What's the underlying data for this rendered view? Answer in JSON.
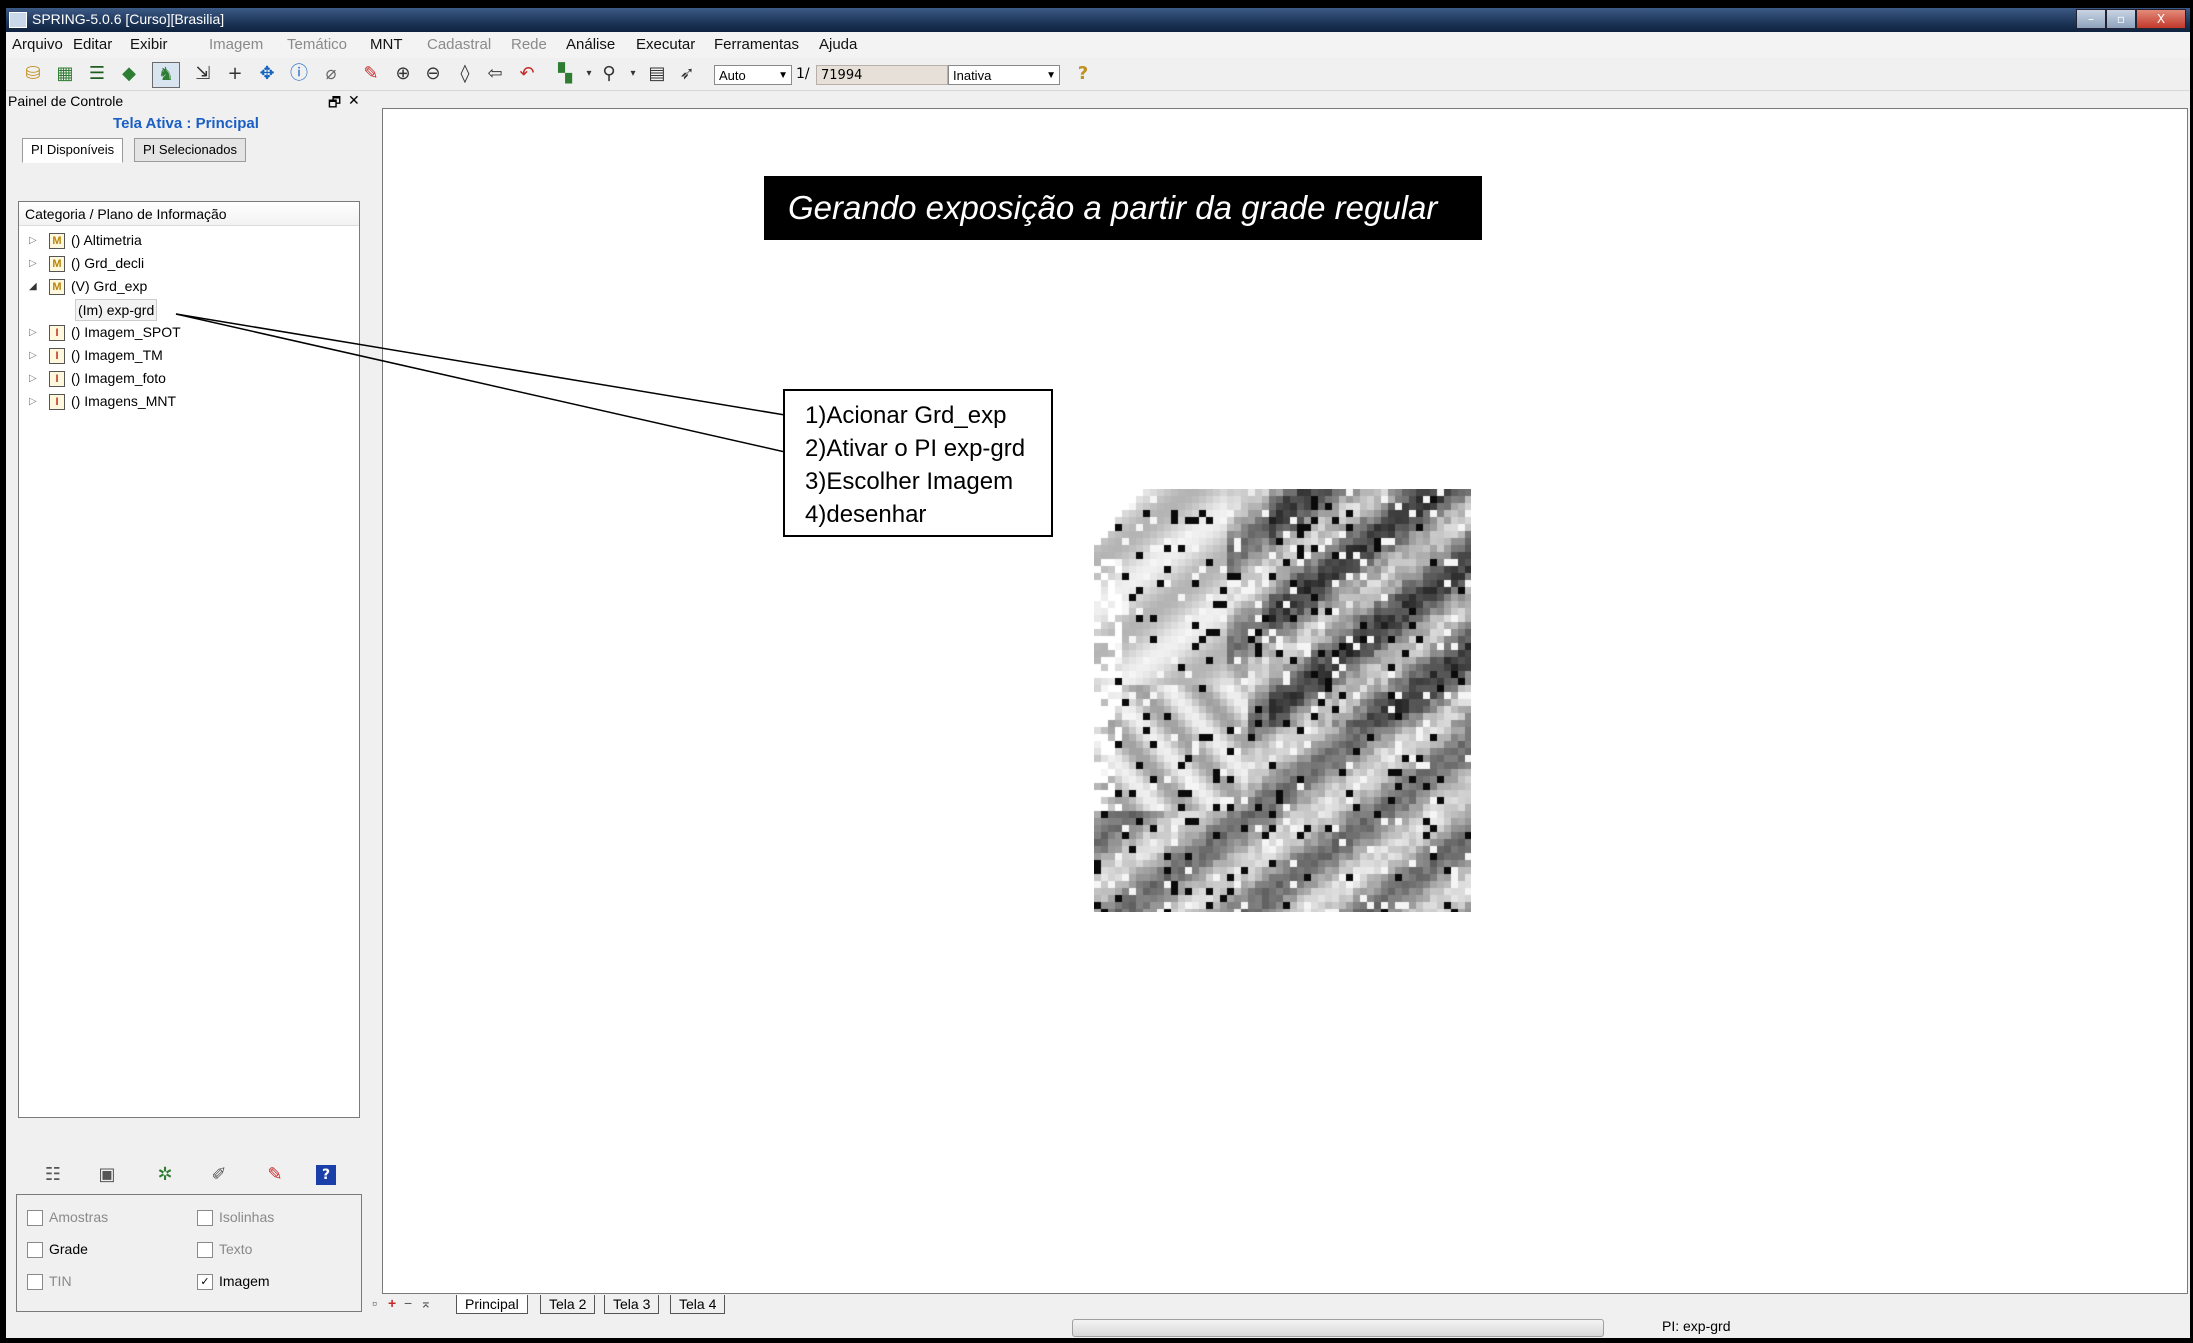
{
  "window": {
    "title": "SPRING-5.0.6 [Curso][Brasilia]",
    "controls": [
      "–",
      "▫",
      "X"
    ]
  },
  "menu": [
    "Arquivo",
    "Editar",
    "Exibir",
    "Imagem",
    "Temático",
    "MNT",
    "Cadastral",
    "Rede",
    "Análise",
    "Executar",
    "Ferramentas",
    "Ajuda"
  ],
  "menu_disabled": [
    "Imagem",
    "Temático",
    "Cadastral",
    "Rede"
  ],
  "toolbar": {
    "zoom_mode": "Auto",
    "scale_prefix": "1/",
    "scale_value": "71994",
    "cursor_mode": "Inativa",
    "help_icon": "?"
  },
  "panel": {
    "title": "Painel de Controle",
    "float_icon": "🗗",
    "close_icon": "✕",
    "tela_ativa": "Tela Ativa : Principal",
    "tabs": [
      "PI Disponíveis",
      "PI Selecionados"
    ],
    "tree_header": "Categoria / Plano de Informação",
    "tree": [
      {
        "expander": "▷",
        "badge": "M",
        "label": "() Altimetria"
      },
      {
        "expander": "▷",
        "badge": "M",
        "label": "() Grd_decli"
      },
      {
        "expander": "◢",
        "badge": "M",
        "label": "(V) Grd_exp"
      },
      {
        "expander": "",
        "badge": "",
        "label": "(Im) exp-grd"
      },
      {
        "expander": "▷",
        "badge": "I",
        "label": "() Imagem_SPOT"
      },
      {
        "expander": "▷",
        "badge": "I",
        "label": "() Imagem_TM"
      },
      {
        "expander": "▷",
        "badge": "I",
        "label": "() Imagem_foto"
      },
      {
        "expander": "▷",
        "badge": "I",
        "label": "() Imagens_MNT"
      }
    ],
    "checkboxes": [
      {
        "label": "Amostras",
        "checked": false,
        "enabled": false
      },
      {
        "label": "Isolinhas",
        "checked": false,
        "enabled": false
      },
      {
        "label": "Grade",
        "checked": false,
        "enabled": true
      },
      {
        "label": "Texto",
        "checked": false,
        "enabled": false
      },
      {
        "label": "TIN",
        "checked": false,
        "enabled": false
      },
      {
        "label": "Imagem",
        "checked": true,
        "enabled": true
      }
    ]
  },
  "canvas": {
    "title": "Gerando exposição a partir da grade regular",
    "steps": [
      "1)Acionar Grd_exp",
      "2)Ativar o PI exp-grd",
      "3)Escolher Imagem",
      "4)desenhar"
    ]
  },
  "bottom_tabs": [
    "Principal",
    "Tela 2",
    "Tela 3",
    "Tela 4"
  ],
  "status": {
    "pi": "PI: exp-grd"
  }
}
